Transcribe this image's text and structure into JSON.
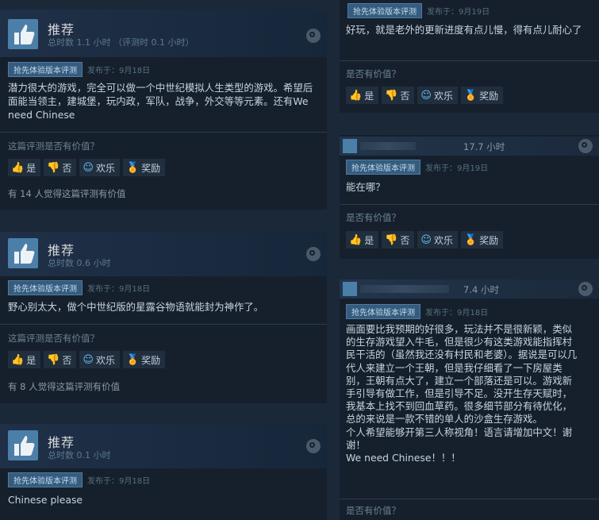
{
  "left_reviews": [
    {
      "title": "推荐",
      "hours": "总时数 1.1 小时 （评测时 0.1 小时）",
      "badge": "抢先体验版本评测",
      "posted": "发布于：9月18日",
      "content": "潜力很大的游戏，完全可以做一个中世纪模拟人生类型的游戏。希望后面能当领主，建城堡，玩内政，军队，战争，外交等等元素。还有We need Chinese",
      "ask": "这篇评测是否有价值？",
      "helpful": "有 14 人觉得这篇评测有价值"
    },
    {
      "title": "推荐",
      "hours": "总时数 0.6 小时",
      "badge": "抢先体验版本评测",
      "posted": "发布于：9月18日",
      "content": "野心别太大，做个中世纪版的星露谷物语就能封为神作了。",
      "ask": "这篇评测是否有价值？",
      "helpful": "有 8 人觉得这篇评测有价值"
    },
    {
      "title": "推荐",
      "hours": "总时数 0.1 小时",
      "badge": "抢先体验版本评测",
      "posted": "发布于：9月18日",
      "content": "Chinese please"
    }
  ],
  "right_reviews": [
    {
      "badge": "抢先体验版本评测",
      "posted": "发布于：9月19日",
      "content": "好玩，就是老外的更新进度有点儿慢，得有点儿耐心了",
      "ask": "是否有价值？"
    },
    {
      "time": "17.7 小时",
      "badge": "抢先体验版本评测",
      "posted": "发布于：9月19日",
      "content": "能在哪？",
      "ask": "是否有价值？"
    },
    {
      "time": "7.4 小时",
      "badge": "抢先体验版本评测",
      "posted": "发布于：9月18日",
      "content": "画面要比我预期的好很多，玩法并不是很新颖，类似的生存游戏望入牛毛，但是很少有这类游戏能指挥村民干活的（虽然我还没有村民和老婆）。据说是可以几代人来建立一个王朝，但是我仔细看了一下房屋类别，王朝有点大了，建立一个部落还是可以。游戏新手引导有做工作，但是引导不足。没开生存天赋时，我基本上找不到回血草药。很多细节部分有待优化，总的来说是一款不错的单人的沙盒生存游戏。\n个人希望能够开第三人称视角！语言请增加中文！谢谢！\nWe need Chinese！！！",
      "ask": "是否有价值？"
    }
  ],
  "buttons": {
    "yes": "是",
    "no": "否",
    "funny": "欢乐",
    "award": "奖励"
  },
  "colors": {
    "background": "#1b2838",
    "accent": "#67c1f5",
    "award": "#f0c030"
  }
}
